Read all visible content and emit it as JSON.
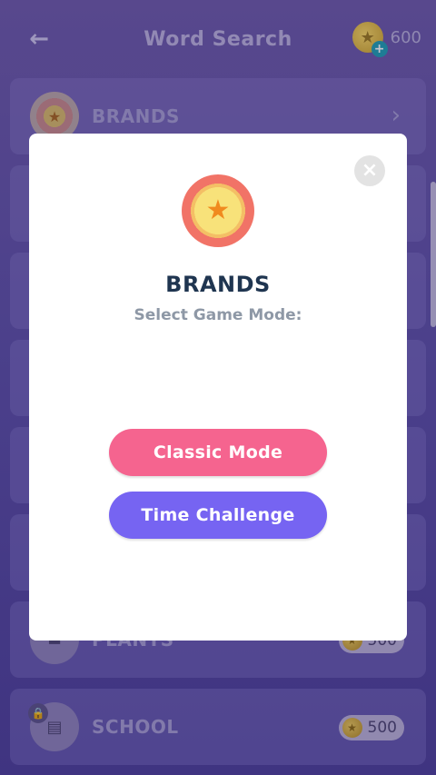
{
  "header": {
    "back_icon": "arrow-left-icon",
    "title": "Word Search",
    "coins": "600"
  },
  "categories": [
    {
      "label": "BRANDS",
      "icon": "star-badge-icon",
      "action": "chevron-right-icon"
    },
    {
      "label": "PLANTS",
      "icon": "plant-pot-icon",
      "price": "500",
      "locked": true
    },
    {
      "label": "SCHOOL",
      "icon": "school-icon",
      "price": "500",
      "locked": true
    }
  ],
  "modal": {
    "title": "BRANDS",
    "subtitle": "Select Game Mode:",
    "classic_label": "Classic Mode",
    "time_label": "Time Challenge",
    "close_icon": "close-icon"
  },
  "colors": {
    "classic_button": "#f5648f",
    "time_button": "#7664f2",
    "title_text": "#1f3550"
  }
}
